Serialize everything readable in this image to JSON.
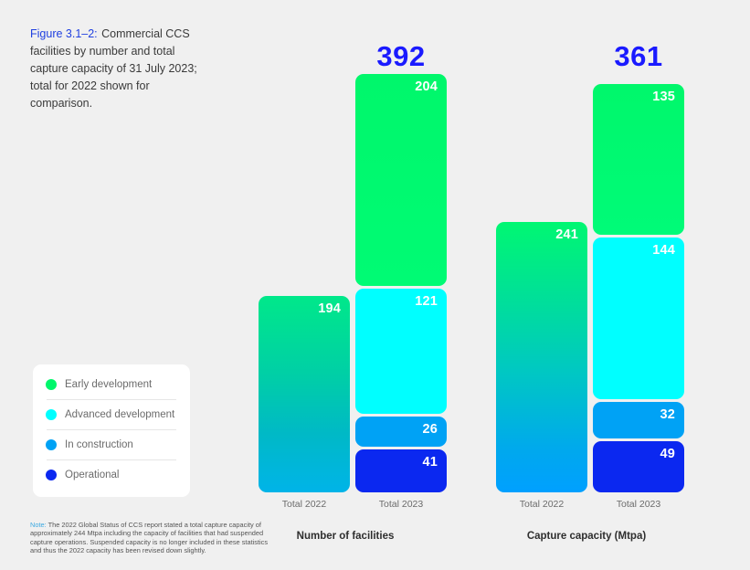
{
  "caption": {
    "figure_label": "Figure 3.1–2:",
    "text": "Commercial CCS facilities by number and total capture capacity of 31 July 2023; total for 2022 shown for comparison."
  },
  "legend": {
    "items": [
      {
        "label": "Early development",
        "color": "#00f76b"
      },
      {
        "label": "Advanced development",
        "color": "#00ffff"
      },
      {
        "label": "In construction",
        "color": "#00a2f5"
      },
      {
        "label": "Operational",
        "color": "#0b28f0"
      }
    ]
  },
  "footnote": {
    "note_word": "Note:",
    "text": " The 2022 Global Status of CCS report stated a total capture capacity of approximately 244 Mtpa including the capacity of facilities that had suspended capture operations. Suspended capacity is no longer included in these statistics and thus the 2022 capacity has been revised down slightly."
  },
  "colors": {
    "background": "#f0f0f0",
    "total_label": "#1a1aff",
    "early_development": "#00f76b",
    "advanced_development": "#00ffff",
    "in_construction": "#00a2f5",
    "operational": "#0b28f0",
    "total_2022_gradient_top": "#00f76b",
    "total_2022_gradient_bottom": "#00b4f0"
  },
  "chart_data": [
    {
      "type": "bar",
      "title": "Number of facilities",
      "stacked": true,
      "categories": [
        "Total 2022",
        "Total 2023"
      ],
      "totals": [
        194,
        392
      ],
      "total_shown": [
        false,
        true
      ],
      "series": [
        {
          "name": "Early development",
          "values": [
            null,
            204
          ],
          "color": "#00f76b"
        },
        {
          "name": "Advanced development",
          "values": [
            null,
            121
          ],
          "color": "#00ffff"
        },
        {
          "name": "In construction",
          "values": [
            null,
            26
          ],
          "color": "#00a2f5"
        },
        {
          "name": "Operational",
          "values": [
            null,
            41
          ],
          "color": "#0b28f0"
        }
      ],
      "combined_2022": {
        "label": "194",
        "value": 194
      },
      "xlabel": "",
      "ylabel": "",
      "grid": false
    },
    {
      "type": "bar",
      "title": "Capture capacity (Mtpa)",
      "stacked": true,
      "categories": [
        "Total 2022",
        "Total 2023"
      ],
      "totals": [
        241,
        361
      ],
      "total_shown": [
        false,
        true
      ],
      "series": [
        {
          "name": "Early development",
          "values": [
            null,
            135
          ],
          "color": "#00f76b"
        },
        {
          "name": "Advanced development",
          "values": [
            null,
            144
          ],
          "color": "#00ffff"
        },
        {
          "name": "In construction",
          "values": [
            null,
            32
          ],
          "color": "#00a2f5"
        },
        {
          "name": "Operational",
          "values": [
            null,
            49
          ],
          "color": "#0b28f0"
        }
      ],
      "combined_2022": {
        "label": "241",
        "value": 241
      },
      "xlabel": "",
      "ylabel": "",
      "grid": false
    }
  ],
  "groups": {
    "facilities": {
      "title": "Number of facilities",
      "total_2022_label": "194",
      "total_2023_header": "392",
      "axis_2022": "Total 2022",
      "axis_2023": "Total 2023",
      "segments_2023": {
        "early": "204",
        "advanced": "121",
        "construction": "26",
        "operational": "41"
      }
    },
    "capacity": {
      "title": "Capture capacity (Mtpa)",
      "total_2022_label": "241",
      "total_2023_header": "361",
      "axis_2022": "Total 2022",
      "axis_2023": "Total 2023",
      "segments_2023": {
        "early": "135",
        "advanced": "144",
        "construction": "32",
        "operational": "49"
      }
    }
  }
}
